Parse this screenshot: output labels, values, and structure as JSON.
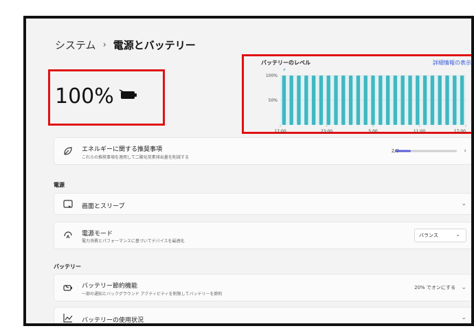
{
  "breadcrumb": {
    "parent": "システム",
    "separator": "›",
    "current": "電源とバッテリー"
  },
  "battery": {
    "percent_label": "100%"
  },
  "chart_data": {
    "type": "bar",
    "title": "バッテリーのレベル",
    "link": "詳細情報の表示",
    "y_ticks": [
      "100%",
      "50%"
    ],
    "x_ticks": [
      "17:00",
      "23:00",
      "5:00",
      "11:00",
      "17:00"
    ],
    "ylim": [
      0,
      100
    ],
    "values": [
      100,
      100,
      100,
      100,
      100,
      100,
      100,
      100,
      100,
      100,
      100,
      100,
      100,
      100,
      100,
      100,
      100,
      100,
      100,
      100,
      100,
      100,
      100,
      100,
      100
    ],
    "bar_color": "#40b8c2",
    "marker": "charging"
  },
  "energy": {
    "title": "エネルギーに関する推奨事項",
    "subtitle": "これらの推奨事項を適用して二酸化炭素排出量を削減する",
    "progress_label": "2/8",
    "progress_value": 0.25
  },
  "sections": {
    "power": "電源",
    "battery": "バッテリー"
  },
  "screen_sleep": {
    "title": "画面とスリープ"
  },
  "power_mode": {
    "title": "電源モード",
    "subtitle": "電力消費とパフォーマンスに基づいてデバイスを最適化",
    "selected": "バランス"
  },
  "battery_saver": {
    "title": "バッテリー節約機能",
    "subtitle": "一部の通知とバックグラウンド アクティビティを制限してバッテリーを節約",
    "status": "20% でオンにする"
  },
  "battery_usage": {
    "title": "バッテリーの使用状況"
  },
  "colors": {
    "accent": "#5a5fd6",
    "highlight": "#e01010",
    "chart_bar": "#40b8c2"
  }
}
